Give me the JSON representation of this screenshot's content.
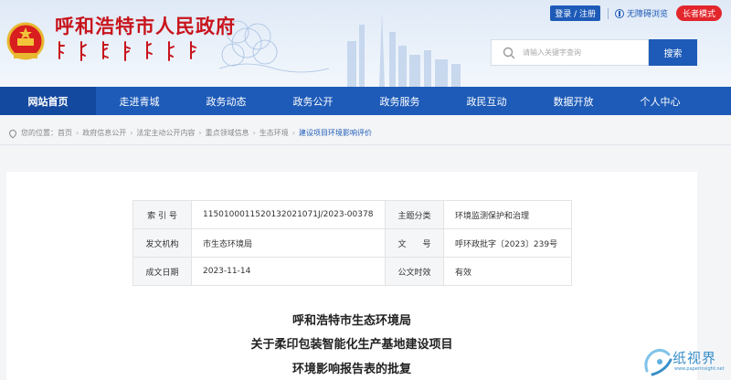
{
  "header": {
    "site_title": "呼和浩特市人民政府",
    "login_label": "登录 / 注册",
    "accessibility_label": "无障碍浏览",
    "elder_mode_label": "长者模式",
    "search_placeholder": "请输入关键字查询",
    "search_button": "搜索"
  },
  "nav": {
    "items": [
      {
        "label": "网站首页",
        "active": true
      },
      {
        "label": "走进青城",
        "active": false
      },
      {
        "label": "政务动态",
        "active": false
      },
      {
        "label": "政务公开",
        "active": false
      },
      {
        "label": "政务服务",
        "active": false
      },
      {
        "label": "政民互动",
        "active": false
      },
      {
        "label": "数据开放",
        "active": false
      },
      {
        "label": "个人中心",
        "active": false
      }
    ]
  },
  "breadcrumb": {
    "prefix": "您的位置：",
    "separator": "›",
    "items": [
      "首页",
      "政府信息公开",
      "法定主动公开内容",
      "重点领域信息",
      "生态环境",
      "建设项目环境影响评价"
    ]
  },
  "meta": {
    "index_no_label": "索 引 号",
    "index_no": "1150100011520132021071J/2023-00378",
    "topic_label": "主题分类",
    "topic": "环境监测保护和治理",
    "issuer_label": "发文机构",
    "issuer": "市生态环境局",
    "doc_no_label": "文　　号",
    "doc_no": "呼环政批字〔2023〕239号",
    "date_label": "成文日期",
    "date": "2023-11-14",
    "validity_label": "公文时效",
    "validity": "有效"
  },
  "document": {
    "title_line1": "呼和浩特市生态环境局",
    "title_line2": "关于柔印包装智能化生产基地建设项目",
    "title_line3": "环境影响报告表的批复"
  },
  "watermark": {
    "text": "纸视界",
    "url": "www.paperinsight.net"
  },
  "colors": {
    "brand_blue": "#1e5bb8",
    "title_red": "#c8141c",
    "elder_red": "#e2262c"
  }
}
